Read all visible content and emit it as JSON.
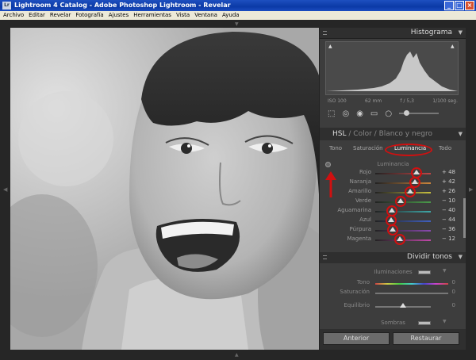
{
  "window": {
    "title": "Lightroom 4 Catalog - Adobe Photoshop Lightroom - Revelar",
    "app_icon": "Lr",
    "buttons": [
      "_",
      "□",
      "×"
    ]
  },
  "menu": [
    "Archivo",
    "Editar",
    "Revelar",
    "Fotografía",
    "Ajustes",
    "Herramientas",
    "Vista",
    "Ventana",
    "Ayuda"
  ],
  "histogram": {
    "title": "Histograma",
    "iso": "ISO 100",
    "focal": "62 mm",
    "aperture": "f / 5,3",
    "shutter": "1/100 seg."
  },
  "hsl": {
    "tab_hsl": "HSL",
    "sep1": "/",
    "tab_color": "Color",
    "sep2": "/",
    "tab_bw": "Blanco y negro",
    "subtabs": [
      "Tono",
      "Saturación",
      "Luminancia",
      "Todo"
    ],
    "section_title": "Luminancia",
    "rows": [
      {
        "label": "Rojo",
        "value": "+ 48",
        "fraction": 0.74,
        "color": "#c24545"
      },
      {
        "label": "Naranja",
        "value": "+ 42",
        "fraction": 0.71,
        "color": "#c9843c"
      },
      {
        "label": "Amarillo",
        "value": "+ 26",
        "fraction": 0.63,
        "color": "#c7bf3f"
      },
      {
        "label": "Verde",
        "value": "− 10",
        "fraction": 0.45,
        "color": "#4a9a4a"
      },
      {
        "label": "Aguamarina",
        "value": "− 40",
        "fraction": 0.3,
        "color": "#3fa8a8"
      },
      {
        "label": "Azul",
        "value": "− 44",
        "fraction": 0.28,
        "color": "#4060c0"
      },
      {
        "label": "Púrpura",
        "value": "− 36",
        "fraction": 0.32,
        "color": "#8a4ab0"
      },
      {
        "label": "Magenta",
        "value": "− 12",
        "fraction": 0.44,
        "color": "#c048a8"
      }
    ]
  },
  "split_toning": {
    "title": "Dividir tonos",
    "highlights": "Iluminaciones",
    "hue_label": "Tono",
    "hue_value": "0",
    "sat_label": "Saturación",
    "sat_value": "0",
    "balance_label": "Equilibrio",
    "balance_value": "0",
    "shadows": "Sombras"
  },
  "buttons": {
    "previous": "Anterior",
    "reset": "Restaurar"
  }
}
